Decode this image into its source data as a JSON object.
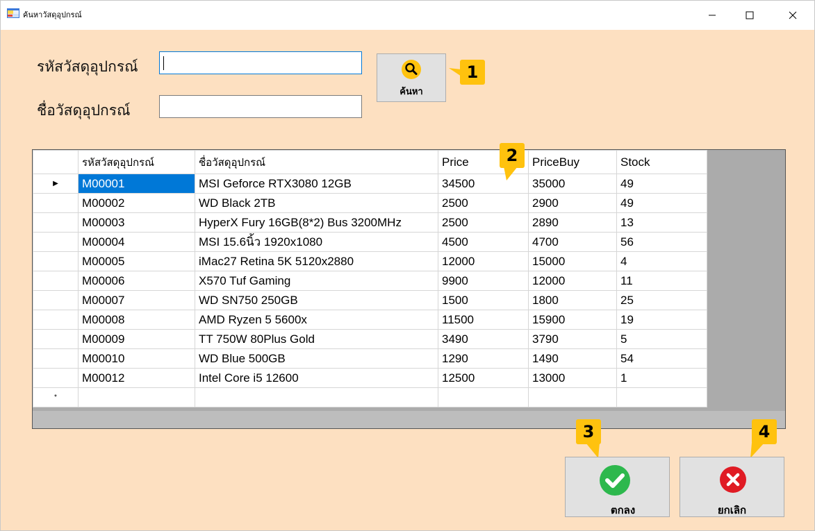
{
  "window": {
    "title": "ค้นหาวัสดุอุปกรณ์",
    "icon": "form-app-icon"
  },
  "controls": {
    "minimize": "minimize-icon",
    "maximize": "maximize-icon",
    "close": "close-icon"
  },
  "search": {
    "code_label": "รหัสวัสดุอุปกรณ์",
    "code_value": "",
    "name_label": "ชื่อวัสดุอุปกรณ์",
    "name_value": "",
    "search_button": "ค้นหา",
    "search_icon": "magnifier-icon"
  },
  "callouts": [
    "1",
    "2",
    "3",
    "4"
  ],
  "grid": {
    "columns": [
      "รหัสวัสดุอุปกรณ์",
      "ชื่อวัสดุอุปกรณ์",
      "Price",
      "PriceBuy",
      "Stock"
    ],
    "rows": [
      [
        "M00001",
        "MSI Geforce RTX3080 12GB",
        "34500",
        "35000",
        "49"
      ],
      [
        "M00002",
        "WD Black 2TB",
        "2500",
        "2900",
        "49"
      ],
      [
        "M00003",
        "HyperX Fury 16GB(8*2) Bus 3200MHz",
        "2500",
        "2890",
        "13"
      ],
      [
        "M00004",
        "MSI 15.6นิ้ว 1920x1080",
        "4500",
        "4700",
        "56"
      ],
      [
        "M00005",
        "iMac27 Retina 5K 5120x2880",
        "12000",
        "15000",
        "4"
      ],
      [
        "M00006",
        "X570 Tuf Gaming",
        "9900",
        "12000",
        "11"
      ],
      [
        "M00007",
        "WD SN750 250GB",
        "1500",
        "1800",
        "25"
      ],
      [
        "M00008",
        "AMD Ryzen 5 5600x",
        "11500",
        "15900",
        "19"
      ],
      [
        "M00009",
        "TT 750W 80Plus Gold",
        "3490",
        "3790",
        "5"
      ],
      [
        "M00010",
        "WD Blue 500GB",
        "1290",
        "1490",
        "54"
      ],
      [
        "M00012",
        "Intel Core i5 12600",
        "12500",
        "13000",
        "1"
      ]
    ],
    "current_row_marker": "▶",
    "new_row_marker": "*"
  },
  "actions": {
    "ok_label": "ตกลง",
    "ok_icon": "check-circle-icon",
    "cancel_label": "ยกเลิก",
    "cancel_icon": "x-circle-icon"
  },
  "colors": {
    "form_bg": "#fde0c1",
    "selection": "#0078d7",
    "callout": "#ffc20e",
    "ok_green": "#2db84d",
    "cancel_red": "#e01b24"
  }
}
